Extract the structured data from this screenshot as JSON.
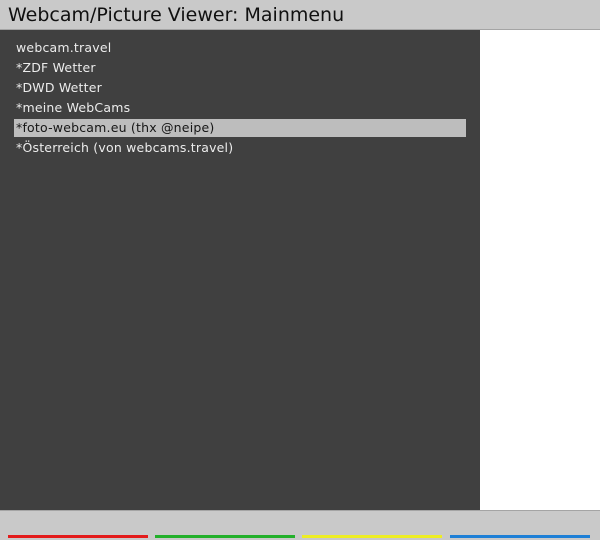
{
  "header": {
    "title": "Webcam/Picture Viewer: Mainmenu"
  },
  "menu": {
    "items": [
      {
        "label": "webcam.travel",
        "selected": false
      },
      {
        "label": "*ZDF Wetter",
        "selected": false
      },
      {
        "label": "*DWD Wetter",
        "selected": false
      },
      {
        "label": "*meine WebCams",
        "selected": false
      },
      {
        "label": "*foto-webcam.eu (thx @neipe)",
        "selected": true
      },
      {
        "label": "*Österreich (von webcams.travel)",
        "selected": false
      }
    ]
  },
  "footer": {
    "color_keys": [
      {
        "name": "red",
        "color": "#e31b1b"
      },
      {
        "name": "green",
        "color": "#22b02a"
      },
      {
        "name": "yellow",
        "color": "#eded23"
      },
      {
        "name": "blue",
        "color": "#1d7fd6"
      }
    ]
  }
}
